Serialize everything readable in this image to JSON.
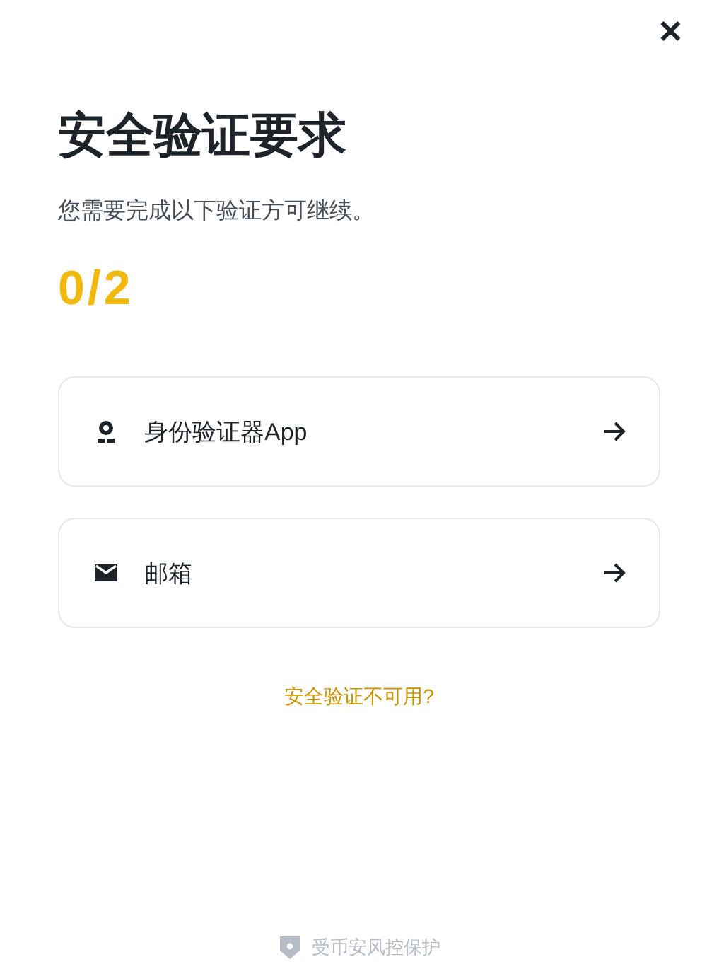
{
  "close_button": {
    "label": "✕"
  },
  "title": "安全验证要求",
  "subtitle": "您需要完成以下验证方可继续。",
  "progress": "0/2",
  "options": [
    {
      "kind": "authenticator",
      "label": "身份验证器App"
    },
    {
      "kind": "email",
      "label": "邮箱"
    }
  ],
  "help_link": "安全验证不可用?",
  "footer": "受币安风控保护"
}
